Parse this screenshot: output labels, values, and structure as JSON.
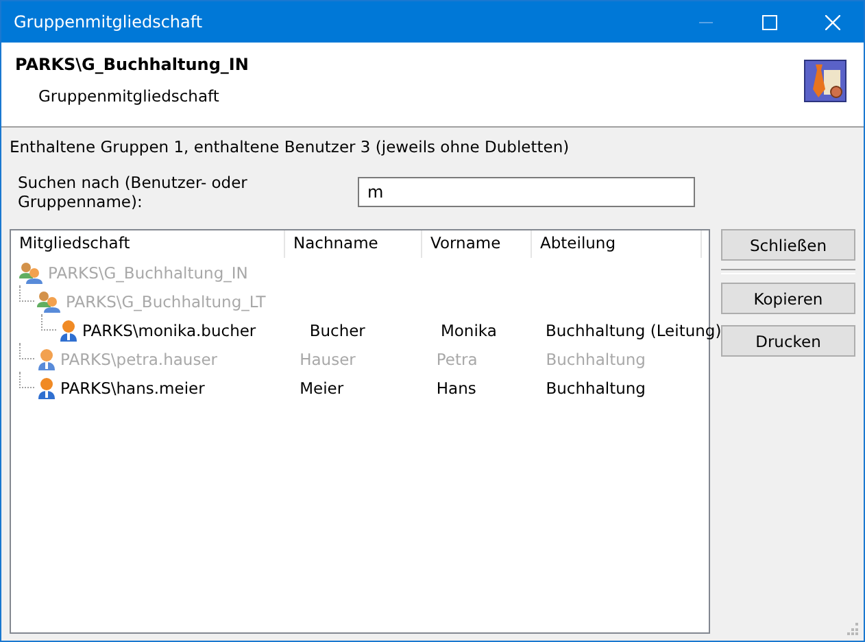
{
  "window": {
    "title": "Gruppenmitgliedschaft"
  },
  "header": {
    "title": "PARKS\\G_Buchhaltung_IN",
    "subtitle": "Gruppenmitgliedschaft"
  },
  "info": "Enthaltene Gruppen 1, enthaltene Benutzer 3 (jeweils ohne Dubletten)",
  "search": {
    "label": "Suchen nach (Benutzer- oder Gruppenname):",
    "value": "m"
  },
  "table": {
    "columns": [
      "Mitgliedschaft",
      "Nachname",
      "Vorname",
      "Abteilung"
    ],
    "rows": [
      {
        "kind": "group",
        "name": "PARKS\\G_Buchhaltung_IN",
        "disabled": true,
        "children": [
          {
            "kind": "group",
            "name": "PARKS\\G_Buchhaltung_LT",
            "disabled": true,
            "children": [
              {
                "kind": "user",
                "name": "PARKS\\monika.bucher",
                "last": "Bucher",
                "first": "Monika",
                "dept": "Buchhaltung (Leitung)",
                "disabled": false
              }
            ]
          },
          {
            "kind": "user",
            "name": "PARKS\\petra.hauser",
            "last": "Hauser",
            "first": "Petra",
            "dept": "Buchhaltung",
            "disabled": true
          },
          {
            "kind": "user",
            "name": "PARKS\\hans.meier",
            "last": "Meier",
            "first": "Hans",
            "dept": "Buchhaltung",
            "disabled": false
          }
        ]
      }
    ]
  },
  "buttons": [
    {
      "label": "Schließen"
    },
    {
      "label": "Kopieren"
    },
    {
      "label": "Drucken"
    }
  ]
}
